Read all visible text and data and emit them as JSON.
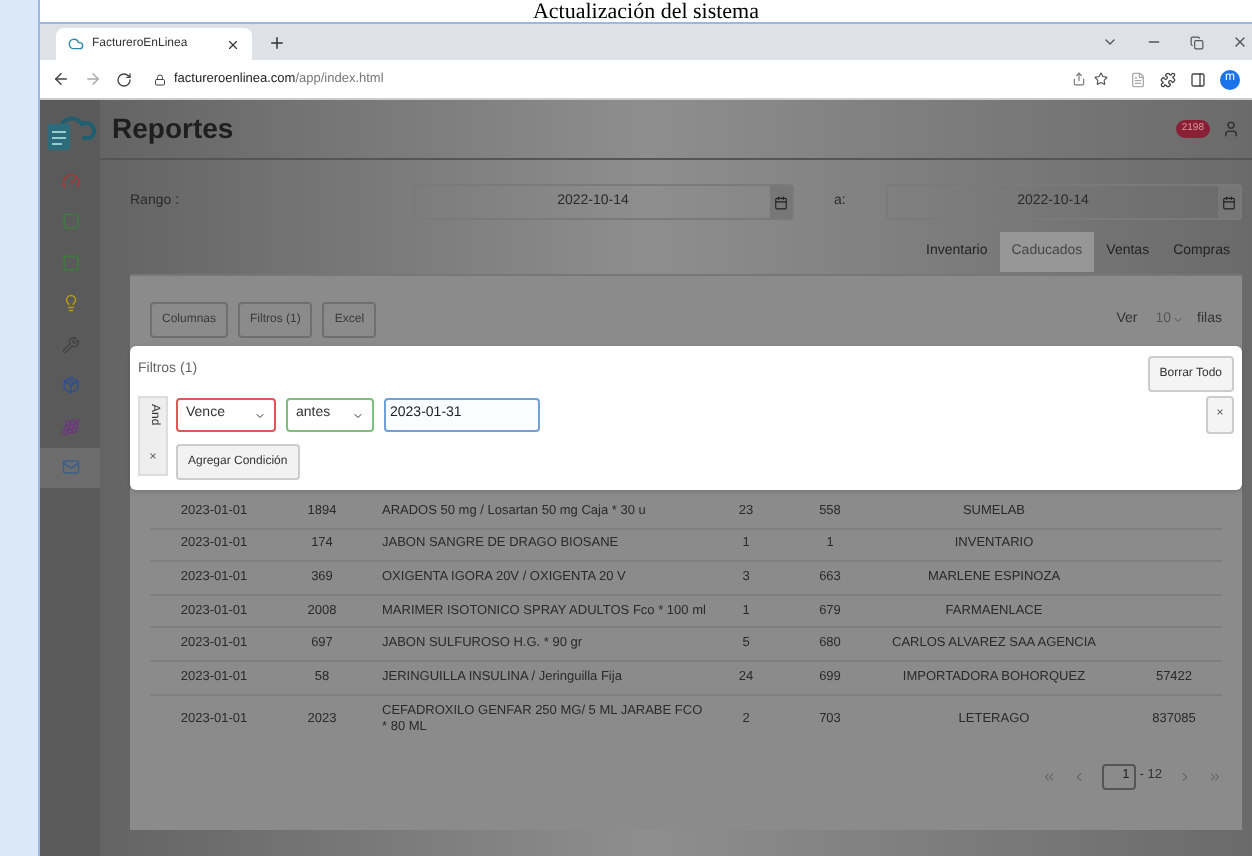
{
  "caption": "Actualización del sistema",
  "browser": {
    "tab_title": "FactureroEnLinea",
    "url_domain": "factureroenlinea.com",
    "url_path": "/app/index.html",
    "profile": "m"
  },
  "header": {
    "title": "Reportes",
    "badge": "2198"
  },
  "sidebar": [
    {
      "selected": false
    },
    {
      "selected": false
    },
    {
      "selected": false
    },
    {
      "selected": false
    },
    {
      "selected": false
    },
    {
      "selected": false
    },
    {
      "selected": false
    },
    {
      "selected": true
    }
  ],
  "range": {
    "label": "Rango :",
    "from": "2022-10-14",
    "separator": "a:",
    "to": "2022-10-14"
  },
  "report_tabs": [
    {
      "label": "Inventario",
      "selected": false
    },
    {
      "label": "Caducados",
      "selected": true
    },
    {
      "label": "Ventas",
      "selected": false
    },
    {
      "label": "Compras",
      "selected": false
    }
  ],
  "toolbar": {
    "buttons": [
      "Columnas",
      "Filtros (1)",
      "Excel"
    ],
    "show_label": "Ver",
    "page_size": "10",
    "rows_label": "filas"
  },
  "filter_dialog": {
    "title": "Filtros (1)",
    "clear_all": "Borrar Todo",
    "group_operator": "And",
    "group_remove": "×",
    "field": "Vence",
    "operator": "antes",
    "value": "2023-01-31",
    "remove": "×",
    "add_condition": "Agregar Condición"
  },
  "table": {
    "rows": [
      [
        "2023-01-01",
        "1894",
        "ARADOS 50 mg / Losartan 50 mg Caja * 30 u",
        "23",
        "558",
        "SUMELAB",
        ""
      ],
      [
        "2023-01-01",
        "174",
        "JABON SANGRE DE DRAGO BIOSANE",
        "1",
        "1",
        "INVENTARIO",
        ""
      ],
      [
        "2023-01-01",
        "369",
        "OXIGENTA IGORA 20V / OXIGENTA 20 V",
        "3",
        "663",
        "MARLENE ESPINOZA",
        ""
      ],
      [
        "2023-01-01",
        "2008",
        "MARIMER ISOTONICO SPRAY ADULTOS Fco * 100 ml",
        "1",
        "679",
        "FARMAENLACE",
        ""
      ],
      [
        "2023-01-01",
        "697",
        "JABON SULFUROSO H.G. * 90 gr",
        "5",
        "680",
        "CARLOS ALVAREZ SAA AGENCIA",
        ""
      ],
      [
        "2023-01-01",
        "58",
        "JERINGUILLA INSULINA / Jeringuilla Fija",
        "24",
        "699",
        "IMPORTADORA BOHORQUEZ",
        "57422"
      ],
      [
        "2023-01-01",
        "2023",
        "CEFADROXILO GENFAR 250 MG/ 5 ML JARABE FCO * 80 ML",
        "2",
        "703",
        "LETERAGO",
        "837085"
      ]
    ]
  },
  "pagination": {
    "page": "1",
    "total": "- 12"
  }
}
